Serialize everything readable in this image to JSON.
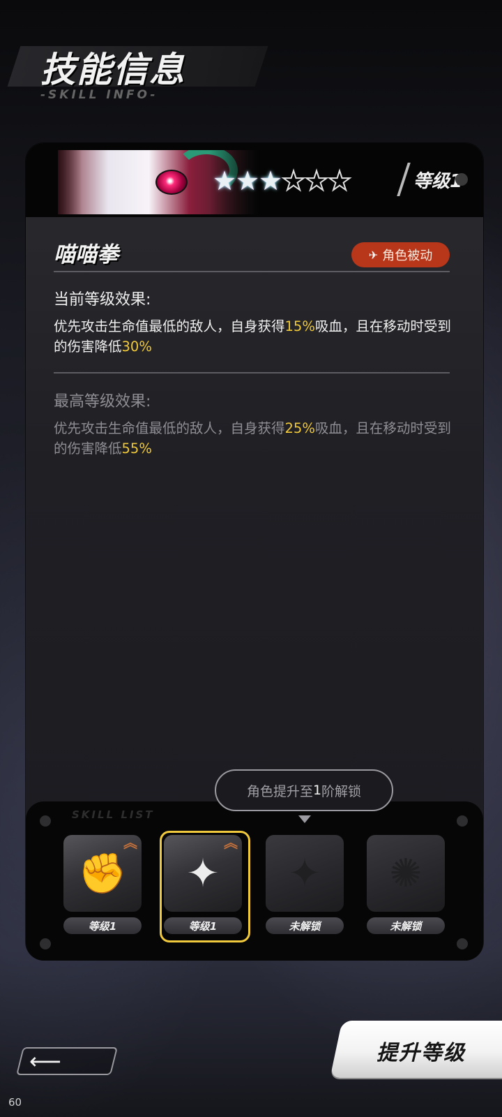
{
  "header": {
    "title": "技能信息",
    "subtitle": "-SKILL INFO-"
  },
  "character": {
    "stars_filled": 3,
    "stars_total": 6,
    "level_label": "等级1"
  },
  "skill": {
    "name": "喵喵拳",
    "type_badge": "角色被动",
    "current": {
      "title": "当前等级效果:",
      "text_before": "优先攻击生命值最低的敌人，自身获得",
      "value1": "15%",
      "text_mid": "吸血，且在移动时受到的伤害降低",
      "value2": "30%"
    },
    "max": {
      "title": "最高等级效果:",
      "text_before": "优先攻击生命值最低的敌人，自身获得",
      "value1": "25%",
      "text_mid": "吸血，且在移动时受到的伤害降低",
      "value2": "55%"
    }
  },
  "tooltip": {
    "prefix": "角色提升至",
    "highlight": "1",
    "suffix": "阶解锁"
  },
  "skill_list": {
    "title": "SKILL LIST",
    "slots": [
      {
        "label": "等级1",
        "icon": "fist-icon",
        "state": "unlocked",
        "upgradable": true,
        "selected": false
      },
      {
        "label": "等级1",
        "icon": "compass-star-icon",
        "state": "unlocked",
        "upgradable": true,
        "selected": true
      },
      {
        "label": "未解锁",
        "icon": "compass-star-icon",
        "state": "locked",
        "upgradable": false,
        "selected": false
      },
      {
        "label": "未解锁",
        "icon": "paw-burst-icon",
        "state": "locked",
        "upgradable": false,
        "selected": false
      }
    ]
  },
  "buttons": {
    "upgrade": "提升等级",
    "back_icon": "left-arrow-icon"
  },
  "fps": "60",
  "colors": {
    "highlight": "#f0c93a",
    "badge": "#b8361a",
    "selected_border": "#f1c93c"
  }
}
